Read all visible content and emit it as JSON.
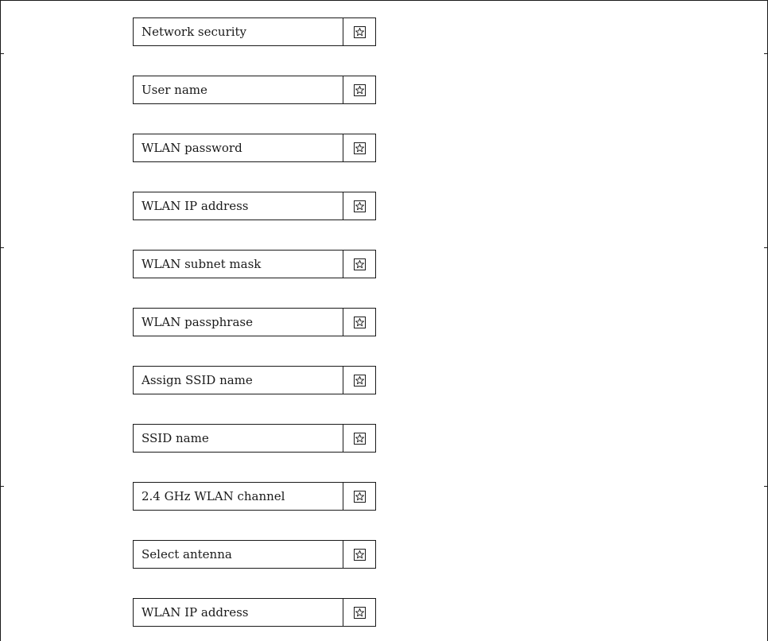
{
  "parameters": [
    {
      "label": "Network security",
      "icon": "star-box-icon"
    },
    {
      "label": "User name",
      "icon": "star-box-icon"
    },
    {
      "label": "WLAN password",
      "icon": "star-box-icon"
    },
    {
      "label": "WLAN IP address",
      "icon": "star-box-icon"
    },
    {
      "label": "WLAN subnet mask",
      "icon": "star-box-icon"
    },
    {
      "label": "WLAN passphrase",
      "icon": "star-box-icon"
    },
    {
      "label": "Assign SSID name",
      "icon": "star-box-icon"
    },
    {
      "label": "SSID name",
      "icon": "star-box-icon"
    },
    {
      "label": "2.4 GHz WLAN channel",
      "icon": "star-box-icon"
    },
    {
      "label": "Select antenna",
      "icon": "star-box-icon"
    },
    {
      "label": "WLAN IP address",
      "icon": "star-box-icon"
    }
  ]
}
